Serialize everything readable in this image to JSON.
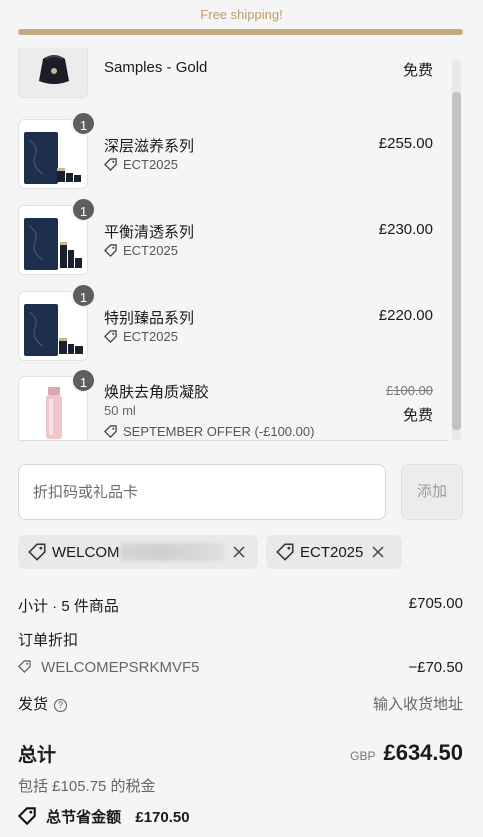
{
  "shipping": {
    "banner": "Free shipping!",
    "progress": 1.0
  },
  "items": [
    {
      "name": "Samples - Gold",
      "price": "免费"
    },
    {
      "qty": "1",
      "name": "深层滋养系列",
      "code": "ECT2025",
      "price": "£255.00"
    },
    {
      "qty": "1",
      "name": "平衡清透系列",
      "code": "ECT2025",
      "price": "£230.00"
    },
    {
      "qty": "1",
      "name": "特别臻品系列",
      "code": "ECT2025",
      "price": "£220.00"
    },
    {
      "qty": "1",
      "name": "焕肤去角质凝胶",
      "variant": "50 ml",
      "code": "SEPTEMBER OFFER (-£100.00)",
      "original_price": "£100.00",
      "price": "免费"
    }
  ],
  "discount_form": {
    "placeholder": "折扣码或礼品卡",
    "add_label": "添加"
  },
  "applied_codes": [
    {
      "label": "WELCOM"
    },
    {
      "label": "ECT2025"
    }
  ],
  "summary": {
    "subtotal_label": "小计 · 5 件商品",
    "subtotal_value": "£705.00",
    "order_discount_label": "订单折扣",
    "discount_code": "WELCOMEPSRKMVF5",
    "discount_value": "−£70.50",
    "shipping_label": "发货",
    "shipping_value": "输入收货地址",
    "total_label": "总计",
    "currency": "GBP",
    "total_value": "£634.50",
    "tax_note": "包括 £105.75 的税金",
    "savings_label": "总节省金额",
    "savings_value": "£170.50"
  },
  "icons": [
    "tag-icon",
    "close-icon",
    "help-icon",
    "savings-tag-icon"
  ]
}
